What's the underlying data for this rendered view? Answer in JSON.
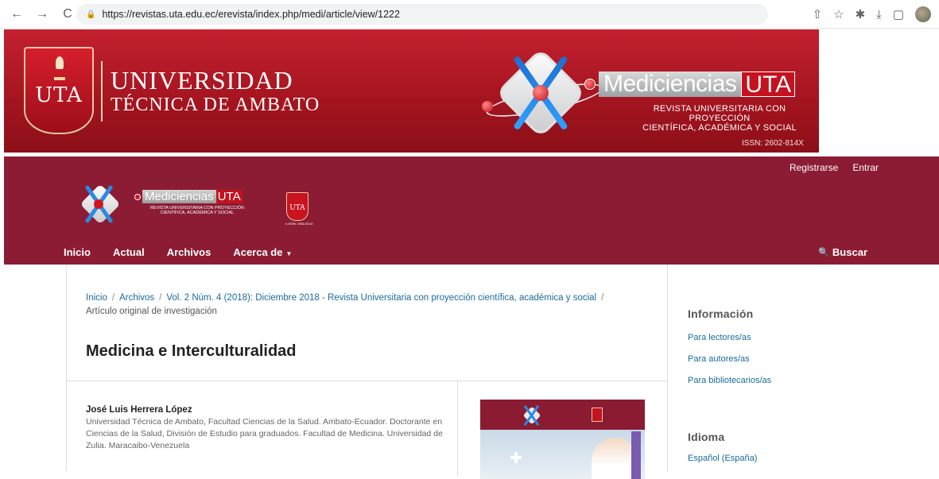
{
  "browser": {
    "url": "https://revistas.uta.edu.ec/erevista/index.php/medi/article/view/1222",
    "back_icon": "←",
    "forward_icon": "→",
    "reload_icon": "C",
    "lock_icon": "🔒",
    "tool_icons": [
      "⇧",
      "☆",
      "✱",
      "⤓",
      "▢"
    ]
  },
  "banner": {
    "uni_shield_text": "UTA",
    "uni_line1": "UNIVERSIDAD",
    "uni_line2": "TÉCNICA DE AMBATO",
    "journal_word": "Mediciencias",
    "journal_suffix": "UTA",
    "journal_sub1": "REVISTA UNIVERSITARIA CON PROYECCIÓN",
    "journal_sub2": "CIENTÍFICA, ACADÉMICA Y SOCIAL",
    "issn": "ISSN: 2602-814X",
    "colors": {
      "banner_red": "#b01a26",
      "header_maroon": "#8c1c34"
    }
  },
  "header": {
    "user_nav": [
      "Registrarse",
      "Entrar"
    ],
    "logo_word": "Mediciencias",
    "logo_suffix": "UTA",
    "logo_sub": "REVISTA UNIVERSITARIA CON PROYECCIÓN CIENTÍFICA, ACADÉMICA Y SOCIAL",
    "mini_shield": "UTA",
    "mini_issn": "e-ISSN: 2602-814X",
    "nav": [
      "Inicio",
      "Actual",
      "Archivos",
      "Acerca de"
    ],
    "caret": "▼",
    "search_label": "Buscar",
    "search_icon": "🔍"
  },
  "main": {
    "breadcrumb": {
      "home": "Inicio",
      "archives": "Archivos",
      "issue": "Vol. 2 Núm. 4 (2018): Diciembre 2018 - Revista Universitaria con proyección científica, académica y social",
      "section": "Artículo original de investigación",
      "separator": "/"
    },
    "title": "Medicina e Interculturalidad",
    "author": {
      "name": "José Luis Herrera López",
      "affiliation": "Universidad Técnica de Ambato, Facultad Ciencias de la Salud. Ambato-Ecuador. Doctorante en Ciencias de la Salud, División de Estudio para graduados. Facultad de Medicina. Universidad de Zulia. Maracaibo-Venezuela"
    }
  },
  "sidebar": {
    "info_title": "Información",
    "info_links": [
      "Para lectores/as",
      "Para autores/as",
      "Para bibliotecarios/as"
    ],
    "lang_title": "Idioma",
    "lang_links": [
      "Español (España)"
    ]
  }
}
